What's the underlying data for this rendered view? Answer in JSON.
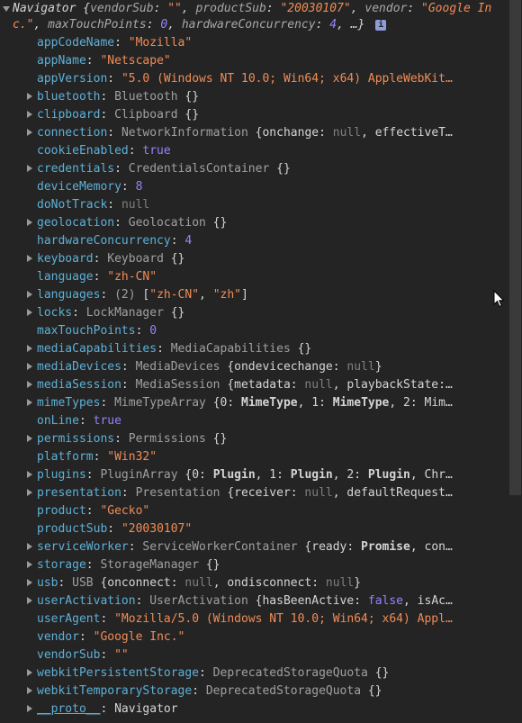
{
  "header": {
    "class_name": "Navigator",
    "preview": [
      {
        "k": "vendorSub",
        "v": "\"\"",
        "t": "str"
      },
      {
        "k": "productSub",
        "v": "\"20030107\"",
        "t": "str"
      },
      {
        "k": "vendor",
        "v": "\"Google Inc.\"",
        "t": "str"
      },
      {
        "k": "maxTouchPoints",
        "v": "0",
        "t": "num"
      },
      {
        "k": "hardwareConcurrency",
        "v": "4",
        "t": "num"
      }
    ],
    "ellipsis": "…}",
    "info_badge": "i"
  },
  "rows": [
    {
      "key": "appCodeName",
      "expandable": false,
      "parts": [
        {
          "t": "str",
          "v": "\"Mozilla\""
        }
      ]
    },
    {
      "key": "appName",
      "expandable": false,
      "parts": [
        {
          "t": "str",
          "v": "\"Netscape\""
        }
      ]
    },
    {
      "key": "appVersion",
      "expandable": false,
      "parts": [
        {
          "t": "str",
          "v": "\"5.0 (Windows NT 10.0; Win64; x64) AppleWebKit…"
        }
      ]
    },
    {
      "key": "bluetooth",
      "expandable": true,
      "parts": [
        {
          "t": "cls",
          "v": "Bluetooth "
        },
        {
          "t": "prev",
          "v": "{}"
        }
      ]
    },
    {
      "key": "clipboard",
      "expandable": true,
      "parts": [
        {
          "t": "cls",
          "v": "Clipboard "
        },
        {
          "t": "prev",
          "v": "{}"
        }
      ]
    },
    {
      "key": "connection",
      "expandable": true,
      "parts": [
        {
          "t": "cls",
          "v": "NetworkInformation "
        },
        {
          "t": "prev",
          "v": "{onchange: "
        },
        {
          "t": "null",
          "v": "null"
        },
        {
          "t": "prev",
          "v": ", effectiveT…"
        }
      ]
    },
    {
      "key": "cookieEnabled",
      "expandable": false,
      "parts": [
        {
          "t": "kw",
          "v": "true"
        }
      ]
    },
    {
      "key": "credentials",
      "expandable": true,
      "parts": [
        {
          "t": "cls",
          "v": "CredentialsContainer "
        },
        {
          "t": "prev",
          "v": "{}"
        }
      ]
    },
    {
      "key": "deviceMemory",
      "expandable": false,
      "parts": [
        {
          "t": "num",
          "v": "8"
        }
      ]
    },
    {
      "key": "doNotTrack",
      "expandable": false,
      "parts": [
        {
          "t": "null",
          "v": "null"
        }
      ]
    },
    {
      "key": "geolocation",
      "expandable": true,
      "parts": [
        {
          "t": "cls",
          "v": "Geolocation "
        },
        {
          "t": "prev",
          "v": "{}"
        }
      ]
    },
    {
      "key": "hardwareConcurrency",
      "expandable": false,
      "parts": [
        {
          "t": "num",
          "v": "4"
        }
      ]
    },
    {
      "key": "keyboard",
      "expandable": true,
      "parts": [
        {
          "t": "cls",
          "v": "Keyboard "
        },
        {
          "t": "prev",
          "v": "{}"
        }
      ]
    },
    {
      "key": "language",
      "expandable": false,
      "parts": [
        {
          "t": "str",
          "v": "\"zh-CN\""
        }
      ]
    },
    {
      "key": "languages",
      "expandable": true,
      "parts": [
        {
          "t": "cls",
          "v": "(2) "
        },
        {
          "t": "prev",
          "v": "["
        },
        {
          "t": "str",
          "v": "\"zh-CN\""
        },
        {
          "t": "prev",
          "v": ", "
        },
        {
          "t": "str",
          "v": "\"zh\""
        },
        {
          "t": "prev",
          "v": "]"
        }
      ]
    },
    {
      "key": "locks",
      "expandable": true,
      "parts": [
        {
          "t": "cls",
          "v": "LockManager "
        },
        {
          "t": "prev",
          "v": "{}"
        }
      ]
    },
    {
      "key": "maxTouchPoints",
      "expandable": false,
      "parts": [
        {
          "t": "num",
          "v": "0"
        }
      ]
    },
    {
      "key": "mediaCapabilities",
      "expandable": true,
      "parts": [
        {
          "t": "cls",
          "v": "MediaCapabilities "
        },
        {
          "t": "prev",
          "v": "{}"
        }
      ]
    },
    {
      "key": "mediaDevices",
      "expandable": true,
      "parts": [
        {
          "t": "cls",
          "v": "MediaDevices "
        },
        {
          "t": "prev",
          "v": "{ondevicechange: "
        },
        {
          "t": "null",
          "v": "null"
        },
        {
          "t": "prev",
          "v": "}"
        }
      ]
    },
    {
      "key": "mediaSession",
      "expandable": true,
      "parts": [
        {
          "t": "cls",
          "v": "MediaSession "
        },
        {
          "t": "prev",
          "v": "{metadata: "
        },
        {
          "t": "null",
          "v": "null"
        },
        {
          "t": "prev",
          "v": ", playbackState:…"
        }
      ]
    },
    {
      "key": "mimeTypes",
      "expandable": true,
      "parts": [
        {
          "t": "cls",
          "v": "MimeTypeArray "
        },
        {
          "t": "prev",
          "v": "{0: "
        },
        {
          "t": "bold",
          "v": "MimeType"
        },
        {
          "t": "prev",
          "v": ", 1: "
        },
        {
          "t": "bold",
          "v": "MimeType"
        },
        {
          "t": "prev",
          "v": ", 2: Mim…"
        }
      ]
    },
    {
      "key": "onLine",
      "expandable": false,
      "parts": [
        {
          "t": "kw",
          "v": "true"
        }
      ]
    },
    {
      "key": "permissions",
      "expandable": true,
      "parts": [
        {
          "t": "cls",
          "v": "Permissions "
        },
        {
          "t": "prev",
          "v": "{}"
        }
      ]
    },
    {
      "key": "platform",
      "expandable": false,
      "parts": [
        {
          "t": "str",
          "v": "\"Win32\""
        }
      ]
    },
    {
      "key": "plugins",
      "expandable": true,
      "parts": [
        {
          "t": "cls",
          "v": "PluginArray "
        },
        {
          "t": "prev",
          "v": "{0: "
        },
        {
          "t": "bold",
          "v": "Plugin"
        },
        {
          "t": "prev",
          "v": ", 1: "
        },
        {
          "t": "bold",
          "v": "Plugin"
        },
        {
          "t": "prev",
          "v": ", 2: "
        },
        {
          "t": "bold",
          "v": "Plugin"
        },
        {
          "t": "prev",
          "v": ", Chr…"
        }
      ]
    },
    {
      "key": "presentation",
      "expandable": true,
      "parts": [
        {
          "t": "cls",
          "v": "Presentation "
        },
        {
          "t": "prev",
          "v": "{receiver: "
        },
        {
          "t": "null",
          "v": "null"
        },
        {
          "t": "prev",
          "v": ", defaultRequest…"
        }
      ]
    },
    {
      "key": "product",
      "expandable": false,
      "parts": [
        {
          "t": "str",
          "v": "\"Gecko\""
        }
      ]
    },
    {
      "key": "productSub",
      "expandable": false,
      "parts": [
        {
          "t": "str",
          "v": "\"20030107\""
        }
      ]
    },
    {
      "key": "serviceWorker",
      "expandable": true,
      "parts": [
        {
          "t": "cls",
          "v": "ServiceWorkerContainer "
        },
        {
          "t": "prev",
          "v": "{ready: "
        },
        {
          "t": "bold",
          "v": "Promise"
        },
        {
          "t": "prev",
          "v": ", con…"
        }
      ]
    },
    {
      "key": "storage",
      "expandable": true,
      "parts": [
        {
          "t": "cls",
          "v": "StorageManager "
        },
        {
          "t": "prev",
          "v": "{}"
        }
      ]
    },
    {
      "key": "usb",
      "expandable": true,
      "parts": [
        {
          "t": "cls",
          "v": "USB "
        },
        {
          "t": "prev",
          "v": "{onconnect: "
        },
        {
          "t": "null",
          "v": "null"
        },
        {
          "t": "prev",
          "v": ", ondisconnect: "
        },
        {
          "t": "null",
          "v": "null"
        },
        {
          "t": "prev",
          "v": "}"
        }
      ]
    },
    {
      "key": "userActivation",
      "expandable": true,
      "parts": [
        {
          "t": "cls",
          "v": "UserActivation "
        },
        {
          "t": "prev",
          "v": "{hasBeenActive: "
        },
        {
          "t": "kw",
          "v": "false"
        },
        {
          "t": "prev",
          "v": ", isAc…"
        }
      ]
    },
    {
      "key": "userAgent",
      "expandable": false,
      "parts": [
        {
          "t": "str",
          "v": "\"Mozilla/5.0 (Windows NT 10.0; Win64; x64) Appl…"
        }
      ]
    },
    {
      "key": "vendor",
      "expandable": false,
      "parts": [
        {
          "t": "str",
          "v": "\"Google Inc.\""
        }
      ]
    },
    {
      "key": "vendorSub",
      "expandable": false,
      "parts": [
        {
          "t": "str",
          "v": "\"\""
        }
      ]
    },
    {
      "key": "webkitPersistentStorage",
      "expandable": true,
      "parts": [
        {
          "t": "cls",
          "v": "DeprecatedStorageQuota "
        },
        {
          "t": "prev",
          "v": "{}"
        }
      ]
    },
    {
      "key": "webkitTemporaryStorage",
      "expandable": true,
      "parts": [
        {
          "t": "cls",
          "v": "DeprecatedStorageQuota "
        },
        {
          "t": "prev",
          "v": "{}"
        }
      ]
    },
    {
      "key": "__proto__",
      "expandable": true,
      "proto": true,
      "parts": [
        {
          "t": "prev",
          "v": "Navigator"
        }
      ]
    }
  ],
  "colors": {
    "background": "#242424",
    "key": "#5db0d7",
    "string": "#f28b54",
    "number": "#9980ff",
    "null": "#7f7f7f",
    "class": "#a0a0a0",
    "badge": "#8e9dd8"
  }
}
